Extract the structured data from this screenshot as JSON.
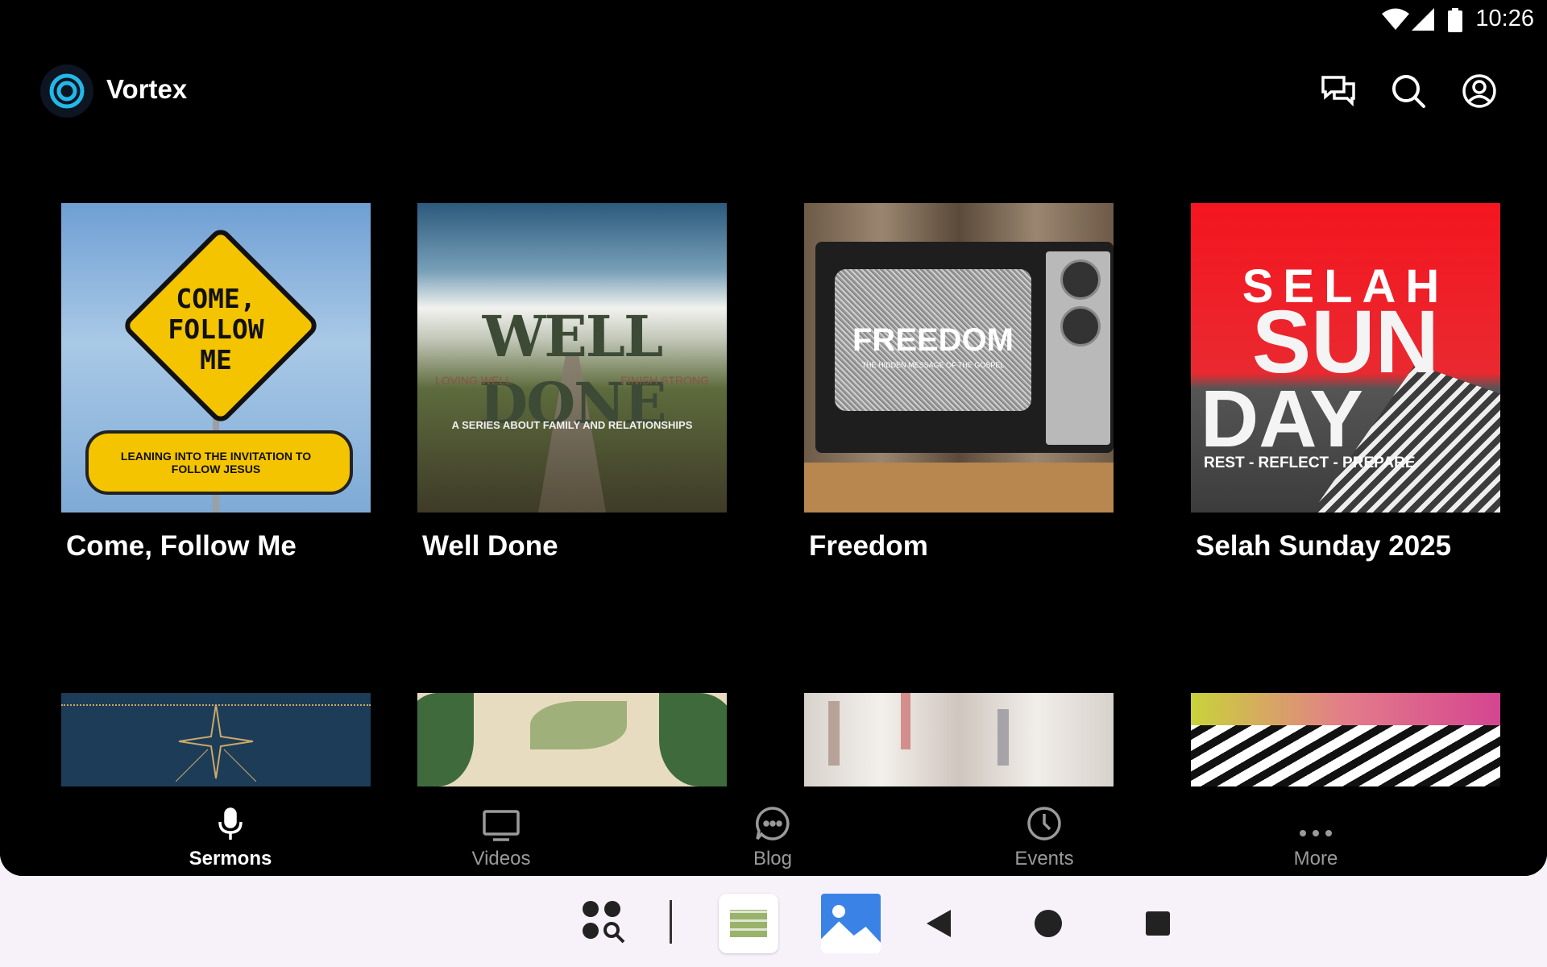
{
  "status": {
    "time": "10:26"
  },
  "app": {
    "name": "Vortex",
    "accent": "#22b8e8",
    "header_icons": [
      "chat-icon",
      "search-icon",
      "account-icon"
    ]
  },
  "series": [
    {
      "title": "Come, Follow Me",
      "art": {
        "headline": "COME, FOLLOW ME",
        "sub": "LEANING INTO THE INVITATION TO FOLLOW JESUS"
      }
    },
    {
      "title": "Well Done",
      "art": {
        "headline": "WELL DONE",
        "left": "LOVING WELL",
        "right": "FINISH STRONG",
        "sub": "A SERIES ABOUT FAMILY AND RELATIONSHIPS"
      }
    },
    {
      "title": "Freedom",
      "art": {
        "headline": "FREEDOM",
        "sub": "THE HIDDEN MESSAGE OF THE GOSPEL"
      }
    },
    {
      "title": "Selah Sunday 2025",
      "art": {
        "line1": "SELAH",
        "line2": "SUN",
        "line3": "DAY",
        "sub": "REST - REFLECT - PREPARE"
      }
    }
  ],
  "nav": {
    "items": [
      {
        "label": "Sermons",
        "icon": "microphone-icon",
        "active": true
      },
      {
        "label": "Videos",
        "icon": "monitor-icon",
        "active": false
      },
      {
        "label": "Blog",
        "icon": "chat-bubble-icon",
        "active": false
      },
      {
        "label": "Events",
        "icon": "clock-icon",
        "active": false
      },
      {
        "label": "More",
        "icon": "more-dots-icon",
        "active": false
      }
    ]
  }
}
